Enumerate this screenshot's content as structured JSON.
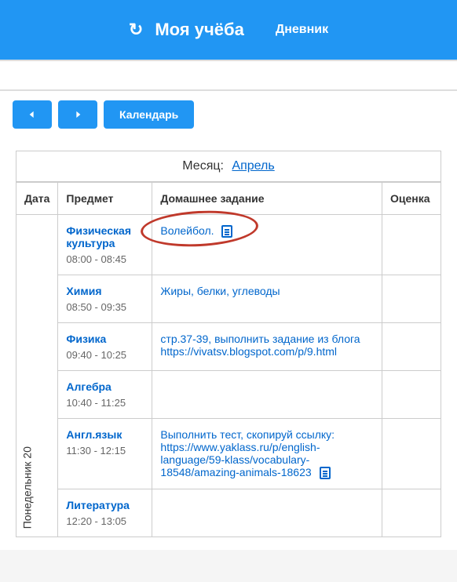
{
  "header": {
    "title": "Моя учёба",
    "diary_link": "Дневник"
  },
  "toolbar": {
    "calendar_label": "Календарь"
  },
  "month": {
    "label": "Месяц:",
    "value": "Апрель"
  },
  "columns": {
    "date": "Дата",
    "subject": "Предмет",
    "homework": "Домашнее задание",
    "grade": "Оценка"
  },
  "day_label": "Понедельник  20",
  "rows": [
    {
      "subject": "Физическая культура",
      "time": "08:00 - 08:45",
      "homework": "Волейбол.",
      "has_doc": true
    },
    {
      "subject": "Химия",
      "time": "08:50 - 09:35",
      "homework": "Жиры, белки, углеводы",
      "has_doc": false
    },
    {
      "subject": "Физика",
      "time": "09:40 - 10:25",
      "homework": "стр.37-39, выполнить задание из блога https://vivatsv.blogspot.com/p/9.html",
      "has_doc": false
    },
    {
      "subject": "Алгебра",
      "time": "10:40 - 11:25",
      "homework": "",
      "has_doc": false
    },
    {
      "subject": "Англ.язык",
      "time": "11:30 - 12:15",
      "homework": "Выполнить тест, скопируй ссылку: https://www.yaklass.ru/p/english-language/59-klass/vocabulary-18548/amazing-animals-18623",
      "has_doc": true
    },
    {
      "subject": "Литература",
      "time": "12:20 - 13:05",
      "homework": "",
      "has_doc": false
    }
  ]
}
